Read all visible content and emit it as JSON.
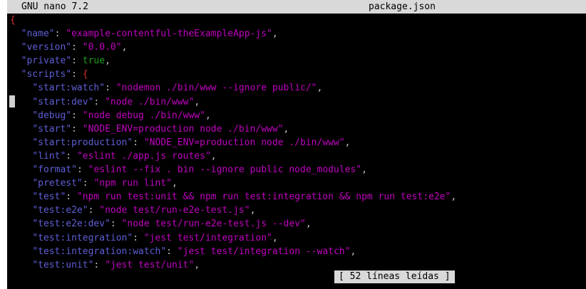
{
  "titlebar": {
    "app": "GNU nano 7.2",
    "file": "package.json"
  },
  "editor": {
    "open_brace": "{",
    "name_key": "\"name\"",
    "name_val": "\"example-contentful-theExampleApp-js\"",
    "version_key": "\"version\"",
    "version_val": "\"0.0.0\"",
    "private_key": "\"private\"",
    "private_val": "true",
    "scripts_key": "\"scripts\"",
    "scripts_open": "{",
    "scripts": [
      {
        "k1": "\"start",
        "c": ":",
        "k2": "watch\"",
        "v": "\"nodemon ./bin/www --ignore public/\""
      },
      {
        "k1": "\"start",
        "c": ":",
        "k2": "dev\"",
        "v": "\"node ./bin/www\""
      },
      {
        "k1": "\"debug\"",
        "c": "",
        "k2": "",
        "v": "\"node debug ./bin/www\""
      },
      {
        "k1": "\"start\"",
        "c": "",
        "k2": "",
        "v": "\"NODE_ENV=production node ./bin/www\""
      },
      {
        "k1": "\"start",
        "c": ":",
        "k2": "production\"",
        "v": "\"NODE_ENV=production node ./bin/www\""
      },
      {
        "k1": "\"lint\"",
        "c": "",
        "k2": "",
        "v": "\"eslint ./app.js routes\""
      },
      {
        "k1": "\"format\"",
        "c": "",
        "k2": "",
        "v": "\"eslint --fix . bin --ignore public node_modules\""
      },
      {
        "k1": "\"pretest\"",
        "c": "",
        "k2": "",
        "v": "\"npm run lint\""
      },
      {
        "k1": "\"test\"",
        "c": "",
        "k2": "",
        "v": "\"npm run test:unit && npm run test:integration && npm run test:e2e\""
      },
      {
        "k1": "\"test",
        "c": ":",
        "k2": "e2e\"",
        "v": "\"node test/run-e2e-test.js\""
      },
      {
        "k1": "\"test",
        "c": ":",
        "k2": "e2e:dev\"",
        "v": "\"node test/run-e2e-test.js --dev\""
      },
      {
        "k1": "\"test",
        "c": ":",
        "k2": "integration\"",
        "v": "\"jest test/integration\""
      },
      {
        "k1": "\"test",
        "c": ":",
        "k2": "integration:watch\"",
        "v": "\"jest test/integration --watch\""
      },
      {
        "k1": "\"test",
        "c": ":",
        "k2": "unit\"",
        "v": "\"jest test/unit\""
      }
    ]
  },
  "status": "[ 52 líneas leídas ]",
  "colors": {
    "key": "#5f5fd7",
    "string": "#c000c0",
    "brace": "#d73030",
    "bool": "#1ea01e",
    "bar": "#d9d9d9"
  }
}
